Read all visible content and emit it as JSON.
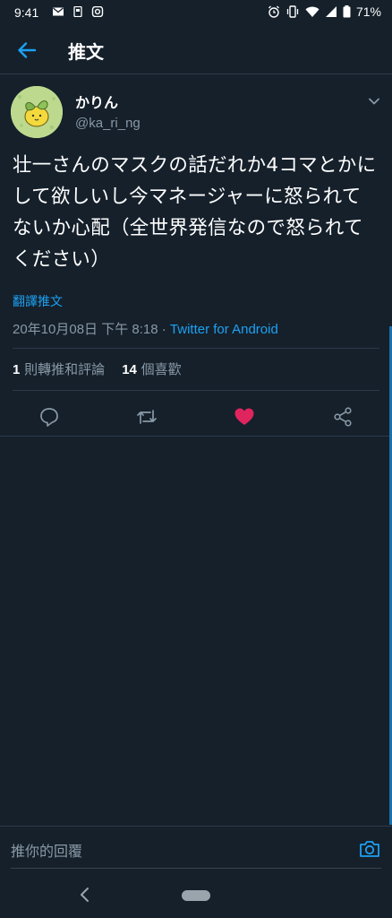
{
  "status_bar": {
    "time": "9:41",
    "battery": "71%",
    "left_icons": [
      "mail-icon",
      "sim-card-icon",
      "instagram-icon"
    ],
    "right_icons": [
      "alarm-icon",
      "vibrate-icon",
      "wifi-icon",
      "signal-icon",
      "battery-icon"
    ]
  },
  "header": {
    "title": "推文",
    "back_icon": "arrow-left-icon"
  },
  "tweet": {
    "display_name": "かりん",
    "handle": "@ka_ri_ng",
    "text": "壮一さんのマスクの話だれか4コマとかにして欲しいし今マネージャーに怒られてないか心配（全世界発信なので怒られてください）",
    "translate": "翻譯推文",
    "timestamp": "20年10月08日 下午 8:18 · ",
    "source": "Twitter for Android",
    "retweets_count": "1",
    "retweets_label": " 則轉推和評論",
    "likes_count": "14",
    "likes_label": " 個喜歡"
  },
  "actions": [
    {
      "name": "reply-icon"
    },
    {
      "name": "retweet-icon"
    },
    {
      "name": "like-icon",
      "color": "#e0245e"
    },
    {
      "name": "share-icon"
    }
  ],
  "reply_bar": {
    "placeholder": "推你的回覆",
    "camera_icon": "camera-icon"
  },
  "colors": {
    "background": "#15202b",
    "accent": "#1da1f2",
    "secondary_text": "#8899a6",
    "like": "#e0245e"
  }
}
